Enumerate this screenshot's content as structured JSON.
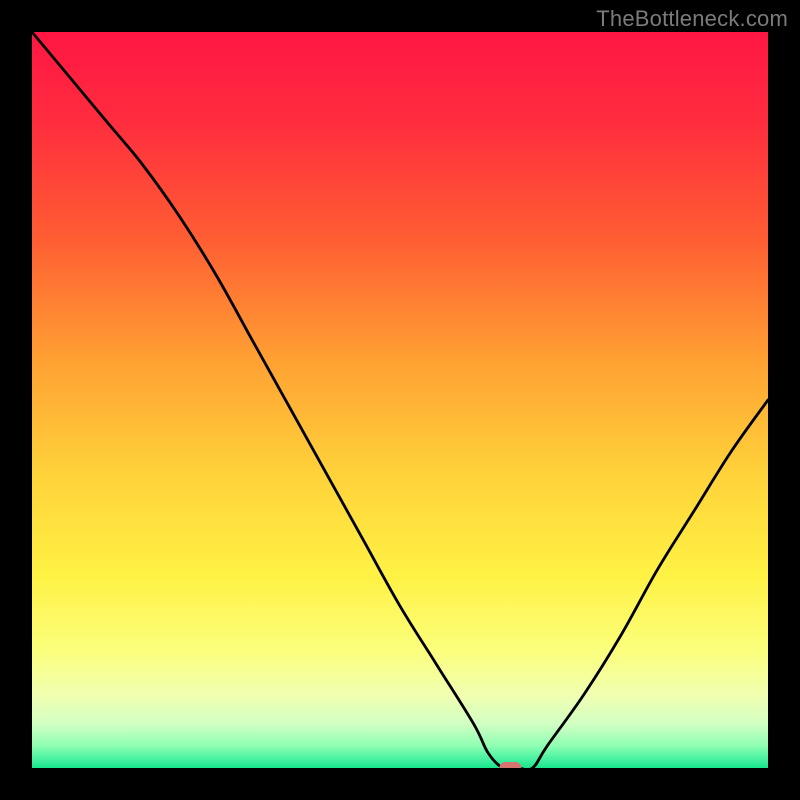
{
  "watermark": "TheBottleneck.com",
  "chart_data": {
    "type": "line",
    "title": "",
    "xlabel": "",
    "ylabel": "",
    "xlim": [
      0,
      100
    ],
    "ylim": [
      0,
      100
    ],
    "x": [
      0,
      5,
      10,
      15,
      20,
      25,
      30,
      35,
      40,
      45,
      50,
      55,
      60,
      62,
      64,
      66,
      68,
      70,
      75,
      80,
      85,
      90,
      95,
      100
    ],
    "values": [
      100,
      94,
      88,
      82,
      75,
      67,
      58,
      49,
      40,
      31,
      22,
      14,
      6,
      2,
      0,
      0,
      0,
      3,
      10,
      18,
      27,
      35,
      43,
      50
    ],
    "marker": {
      "x": 65,
      "y": 0
    },
    "gradient_stops": [
      {
        "offset": 0.0,
        "color": "#ff1643"
      },
      {
        "offset": 0.12,
        "color": "#ff2c3e"
      },
      {
        "offset": 0.28,
        "color": "#ff5d33"
      },
      {
        "offset": 0.45,
        "color": "#ffa233"
      },
      {
        "offset": 0.6,
        "color": "#ffd23a"
      },
      {
        "offset": 0.74,
        "color": "#fff245"
      },
      {
        "offset": 0.84,
        "color": "#fbff7c"
      },
      {
        "offset": 0.9,
        "color": "#f1ffb0"
      },
      {
        "offset": 0.94,
        "color": "#d2ffc3"
      },
      {
        "offset": 0.97,
        "color": "#8effb3"
      },
      {
        "offset": 0.99,
        "color": "#3fef9e"
      },
      {
        "offset": 1.0,
        "color": "#17e68c"
      }
    ]
  }
}
